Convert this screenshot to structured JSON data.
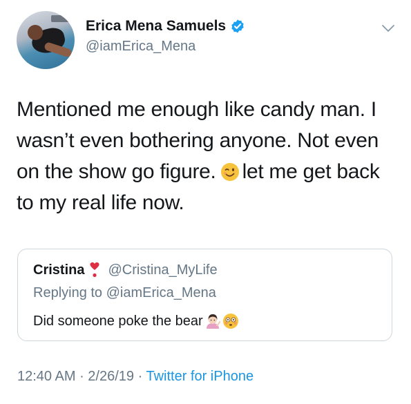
{
  "author": {
    "name": "Erica Mena Samuels",
    "handle": "@iamErica_Mena",
    "verified": true
  },
  "tweet": {
    "text_part1": "Mentioned me enough like candy man. I wasn’t even bothering anyone. Not even on the show go figure.",
    "emoji": "winking-face",
    "text_part2": "let me get back to my real life now."
  },
  "quoted_tweet": {
    "name": "Cristina",
    "name_emoji": "heart-exclamation",
    "handle": "@Cristina_MyLife",
    "replying_to": "Replying to @iamErica_Mena",
    "text": "Did someone poke the bear",
    "emojis": [
      "person-tipping-hand",
      "flushed-face"
    ]
  },
  "meta": {
    "time": "12:40 AM",
    "separator": " · ",
    "date": "2/26/19",
    "source": "Twitter for iPhone"
  },
  "colors": {
    "text": "#14171a",
    "secondary": "#657786",
    "link": "#1b95e0",
    "verified": "#1da1f2",
    "border": "#ccd6dd"
  }
}
